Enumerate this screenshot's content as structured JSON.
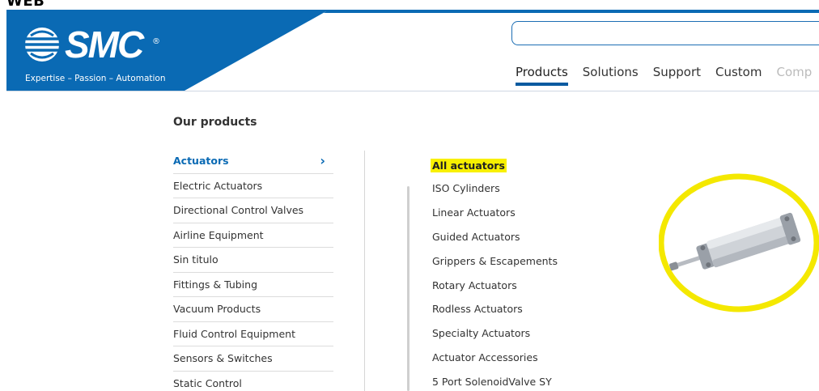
{
  "caption": {
    "label": "WEB"
  },
  "header": {
    "logo_text": "SMC",
    "logo_reg": "®",
    "tagline": "Expertise – Passion – Automation",
    "brand_color": "#0a6ab4",
    "search": {
      "placeholder": ""
    }
  },
  "nav": {
    "items": [
      "Products",
      "Solutions",
      "Support",
      "Custom",
      "Comp"
    ]
  },
  "main": {
    "title": "Our products",
    "categories": [
      "Actuators",
      "Electric Actuators",
      "Directional Control Valves",
      "Airline Equipment",
      "Sin titulo",
      "Fittings & Tubing",
      "Vacuum Products",
      "Fluid Control Equipment",
      "Sensors & Switches",
      "Static Control"
    ],
    "active_chevron": "›",
    "all_label": "All actuators",
    "subcategories": [
      "ISO Cylinders",
      "Linear Actuators",
      "Guided Actuators",
      "Grippers & Escapements",
      "Rotary Actuators",
      "Rodless Actuators",
      "Specialty Actuators",
      "Actuator Accessories",
      "5 Port SolenoidValve SY"
    ]
  },
  "colors": {
    "highlight": "#f8f000",
    "active_link": "#0a6ab4"
  }
}
